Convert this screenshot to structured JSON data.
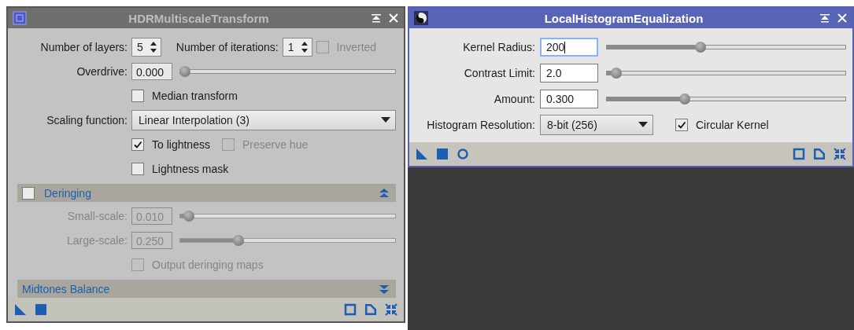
{
  "hdr_window": {
    "title": "HDRMultiscaleTransform",
    "active": false,
    "layers": {
      "label": "Number of layers:",
      "value": "5"
    },
    "iterations": {
      "label": "Number of iterations:",
      "value": "1"
    },
    "inverted": {
      "label": "Inverted",
      "checked": false,
      "disabled": true
    },
    "overdrive": {
      "label": "Overdrive:",
      "value": "0.000",
      "level": 0,
      "disabled": false
    },
    "median_transform": {
      "label": "Median transform",
      "checked": false,
      "disabled": false
    },
    "scaling_function": {
      "label": "Scaling function:",
      "value": "Linear Interpolation (3)"
    },
    "to_lightness": {
      "label": "To lightness",
      "checked": true,
      "disabled": false
    },
    "preserve_hue": {
      "label": "Preserve hue",
      "checked": false,
      "disabled": true
    },
    "lightness_mask": {
      "label": "Lightness mask",
      "checked": false,
      "disabled": false
    },
    "deringing": {
      "title": "Deringing",
      "checked": false,
      "expanded": true,
      "small_scale": {
        "label": "Small-scale:",
        "value": "0.010",
        "level": 0.02,
        "disabled": true
      },
      "large_scale": {
        "label": "Large-scale:",
        "value": "0.250",
        "level": 0.26,
        "disabled": true
      },
      "output_maps": {
        "label": "Output deringing maps",
        "checked": false,
        "disabled": true
      }
    },
    "midtones_balance": {
      "title": "Midtones Balance",
      "expanded": false
    }
  },
  "lhe_window": {
    "title": "LocalHistogramEqualization",
    "active": true,
    "params": [
      {
        "label": "Kernel Radius:",
        "value": "200",
        "level": 0.39,
        "focused": true
      },
      {
        "label": "Contrast Limit:",
        "value": "2.0",
        "level": 0.02,
        "focused": false
      },
      {
        "label": "Amount:",
        "value": "0.300",
        "level": 0.32,
        "focused": false
      }
    ],
    "histogram_resolution": {
      "label": "Histogram Resolution:",
      "value": "8-bit (256)"
    },
    "circular_kernel": {
      "label": "Circular Kernel",
      "checked": true,
      "disabled": false
    }
  }
}
